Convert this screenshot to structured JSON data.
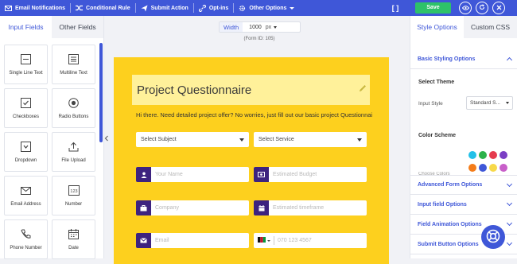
{
  "toolbar": {
    "items": [
      {
        "label": "Email Notifications",
        "icon": "envelope-icon"
      },
      {
        "label": "Conditional Rule",
        "icon": "shuffle-icon"
      },
      {
        "label": "Submit Action",
        "icon": "send-icon"
      },
      {
        "label": "Opt-ins",
        "icon": "link-icon"
      },
      {
        "label": "Other Options",
        "icon": "gear-icon"
      }
    ],
    "bracket_label": "[ ]",
    "save_label": "Save",
    "accent_color": "#3f57d8",
    "save_color": "#2ec26a"
  },
  "left_panel": {
    "tabs": [
      "Input Fields",
      "Other Fields"
    ],
    "fields": [
      {
        "label": "Single Line Text",
        "icon": "single-line-icon"
      },
      {
        "label": "Multiline Text",
        "icon": "multiline-icon"
      },
      {
        "label": "Checkboxes",
        "icon": "checkbox-icon"
      },
      {
        "label": "Radio Buttons",
        "icon": "radio-icon"
      },
      {
        "label": "Dropdown",
        "icon": "dropdown-icon"
      },
      {
        "label": "File Upload",
        "icon": "upload-icon"
      },
      {
        "label": "Email Address",
        "icon": "envelope-icon"
      },
      {
        "label": "Number",
        "icon": "number-icon"
      },
      {
        "label": "Phone Number",
        "icon": "phone-icon"
      },
      {
        "label": "Date",
        "icon": "calendar-icon"
      }
    ]
  },
  "canvas": {
    "width_label": "Width",
    "width_value": "1000",
    "width_unit": "px",
    "form_id": "(Form ID: 105)",
    "form": {
      "title": "Project Questionnaire",
      "intro": "Hi there. Need detailed project offer? No worries, just fill out our basic project Questionnaire.",
      "select_subject": "Select Subject",
      "select_service": "Select Service",
      "inputs": [
        {
          "placeholder": "Your Name",
          "icon": "user-icon"
        },
        {
          "placeholder": "Estimated Budget",
          "icon": "money-icon"
        },
        {
          "placeholder": "Company",
          "icon": "briefcase-icon"
        },
        {
          "placeholder": "Estimated timeframe",
          "icon": "calendar-icon"
        },
        {
          "placeholder": "Email",
          "icon": "envelope-icon"
        }
      ],
      "phone_placeholder": "070 123 4567",
      "bg_color": "#fdd01e",
      "title_bg_color": "#fff19a",
      "icon_color": "#3d237f"
    }
  },
  "right_panel": {
    "tabs": [
      "Style Options",
      "Custom CSS"
    ],
    "sections": {
      "basic": "Basic Styling Options",
      "select_theme": "Select Theme",
      "input_style_label": "Input Style",
      "input_style_value": "Standard S...",
      "color_scheme": "Color Scheme",
      "color_scheme_hidden": "Choose Colors",
      "advanced": "Advanced Form Options",
      "input_field": "Input field Options",
      "field_animation": "Field Animation Options",
      "submit_button": "Submit Button Options"
    },
    "swatches": [
      "#22c0e8",
      "#2db14a",
      "#e53c4f",
      "#7b3fc4",
      "#f47c1a",
      "#3f57d8",
      "#f7d94a",
      "#c85fc9"
    ]
  }
}
